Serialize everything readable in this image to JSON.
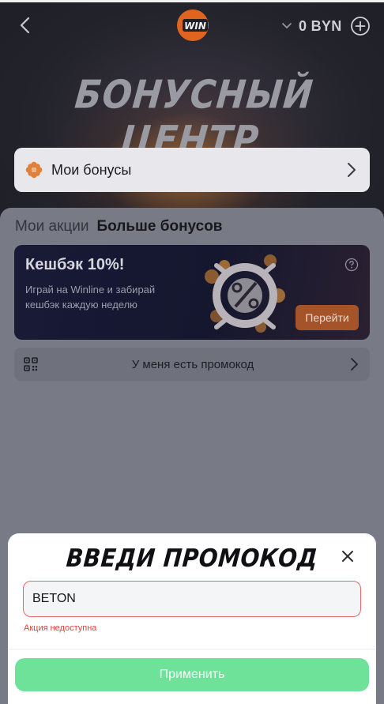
{
  "header": {
    "back_icon": "chevron-left-icon",
    "logo_text": "WIN",
    "balance": "0 BYN",
    "balance_dropdown_icon": "chevron-down-icon",
    "add_funds_icon": "plus-circle-icon"
  },
  "hero": {
    "title": "БОНУСНЫЙ ЦЕНТР"
  },
  "my_bonuses": {
    "label": "Мои бонусы",
    "icon": "flower-icon"
  },
  "tabs": [
    {
      "label": "Мои акции",
      "active": false
    },
    {
      "label": "Больше бонусов",
      "active": true
    }
  ],
  "promo_card": {
    "title": "Кешбэк 10%!",
    "description": "Играй на Winline и забирай кешбэк каждую неделю",
    "button_label": "Перейти",
    "help_icon": "question-circle-icon"
  },
  "promo_code_row": {
    "label": "У меня есть промокод",
    "icon": "qr-code-icon"
  },
  "sheet": {
    "title": "ВВЕДИ ПРОМОКОД",
    "input_value": "BETON",
    "error": "Акция недоступна",
    "apply_label": "Применить"
  },
  "colors": {
    "apply_button": "#6fe29a",
    "error": "#e23f3f",
    "accent_orange": "#a5542a",
    "card_bg": "#181a37"
  }
}
